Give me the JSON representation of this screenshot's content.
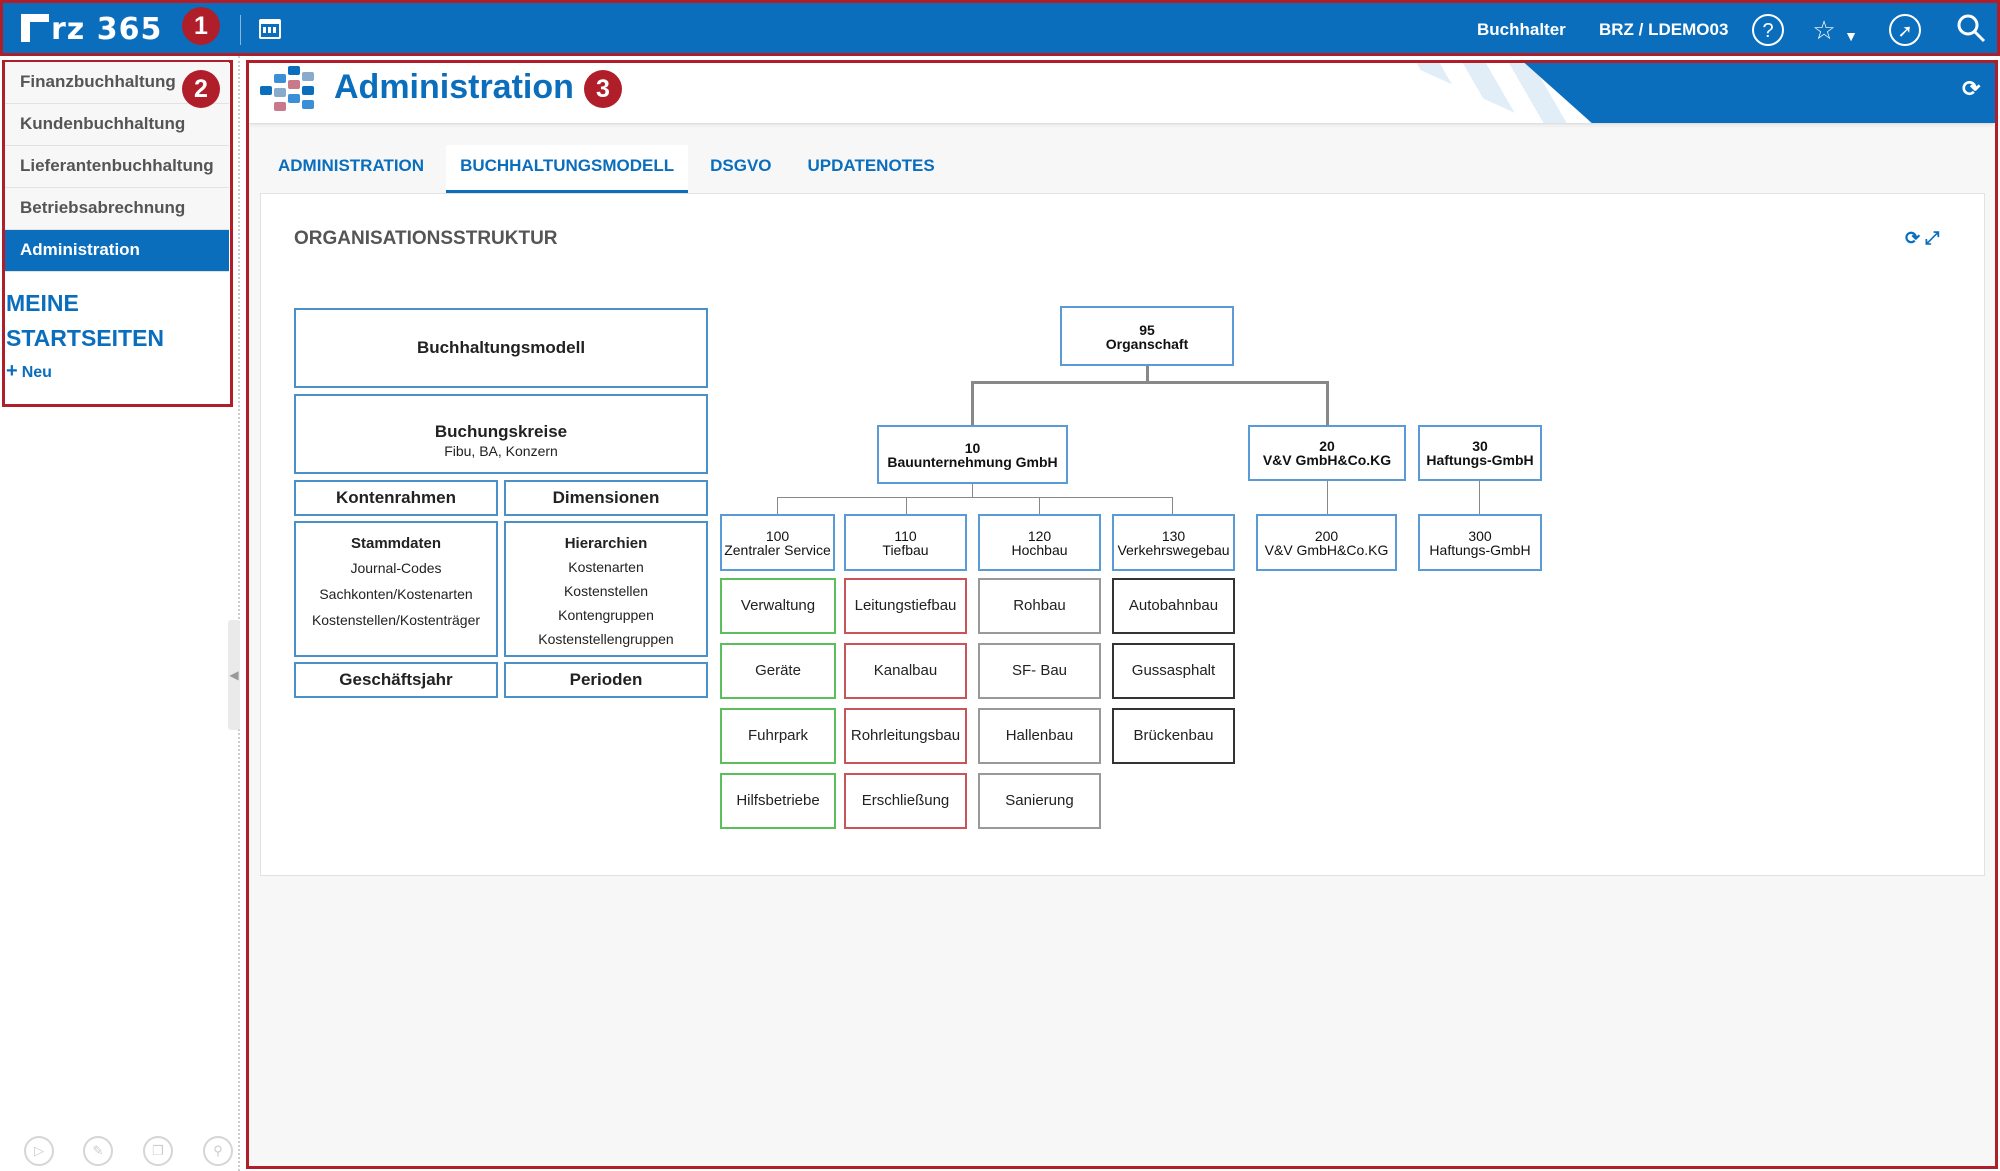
{
  "topbar": {
    "logo_text": "rz 365",
    "role": "Buchhalter",
    "client": "BRZ / LDEMO03",
    "icons": [
      "calendar-icon",
      "help-icon",
      "star-icon",
      "chevron-down-icon",
      "compass-icon",
      "search-icon"
    ]
  },
  "badges": [
    "1",
    "2",
    "3"
  ],
  "sidebar": {
    "items": [
      {
        "label": "Finanzbuchhaltung"
      },
      {
        "label": "Kundenbuchhaltung"
      },
      {
        "label": "Lieferantenbuchhaltung"
      },
      {
        "label": "Betriebsabrechnung"
      },
      {
        "label": "Administration",
        "active": true
      }
    ],
    "startseiten_title": "MEINE STARTSEITEN",
    "neu_label": "Neu"
  },
  "header": {
    "title": "Administration"
  },
  "tabs": [
    {
      "label": "ADMINISTRATION"
    },
    {
      "label": "BUCHHALTUNGSMODELL",
      "active": true
    },
    {
      "label": "DSGVO"
    },
    {
      "label": "UPDATENOTES"
    }
  ],
  "card": {
    "title": "ORGANISATIONSSTRUKTUR",
    "model": {
      "buchhaltungsmodell": "Buchhaltungsmodell",
      "buchungskreise": "Buchungskreise",
      "buchungskreise_sub": "Fibu, BA, Konzern",
      "kontenrahmen": "Kontenrahmen",
      "dimensionen": "Dimensionen",
      "stammdaten": "Stammdaten",
      "stammdaten_items": [
        "Journal-Codes",
        "Sachkonten/Kostenarten",
        "Kostenstellen/Kostenträger"
      ],
      "hierarchien": "Hierarchien",
      "hierarchien_items": [
        "Kostenarten",
        "Kostenstellen",
        "Kontengruppen",
        "Kostenstellengruppen"
      ],
      "geschaeftsjahr": "Geschäftsjahr",
      "perioden": "Perioden"
    },
    "org": {
      "root": {
        "num": "95",
        "name": "Organschaft"
      },
      "level1": [
        {
          "num": "10",
          "name": "Bauunternehmung GmbH"
        },
        {
          "num": "20",
          "name": "V&V GmbH&Co.KG"
        },
        {
          "num": "30",
          "name": "Haftungs-GmbH"
        }
      ],
      "level2": [
        {
          "num": "100",
          "name": "Zentraler Service"
        },
        {
          "num": "110",
          "name": "Tiefbau"
        },
        {
          "num": "120",
          "name": "Hochbau"
        },
        {
          "num": "130",
          "name": "Verkehrswegebau"
        },
        {
          "num": "200",
          "name": "V&V GmbH&Co.KG"
        },
        {
          "num": "300",
          "name": "Haftungs-GmbH"
        }
      ],
      "leaves": {
        "col100": [
          "Verwaltung",
          "Geräte",
          "Fuhrpark",
          "Hilfsbetriebe"
        ],
        "col110": [
          "Leitungstiefbau",
          "Kanalbau",
          "Rohrleitungsbau",
          "Erschließung"
        ],
        "col120": [
          "Rohbau",
          "SF- Bau",
          "Hallenbau",
          "Sanierung"
        ],
        "col130": [
          "Autobahnbau",
          "Gussasphalt",
          "Brückenbau"
        ]
      }
    }
  },
  "colors": {
    "brand": "#0a6ebd",
    "frame": "#b01e2a",
    "green": "#5cbf5c",
    "red": "#c8555c"
  }
}
